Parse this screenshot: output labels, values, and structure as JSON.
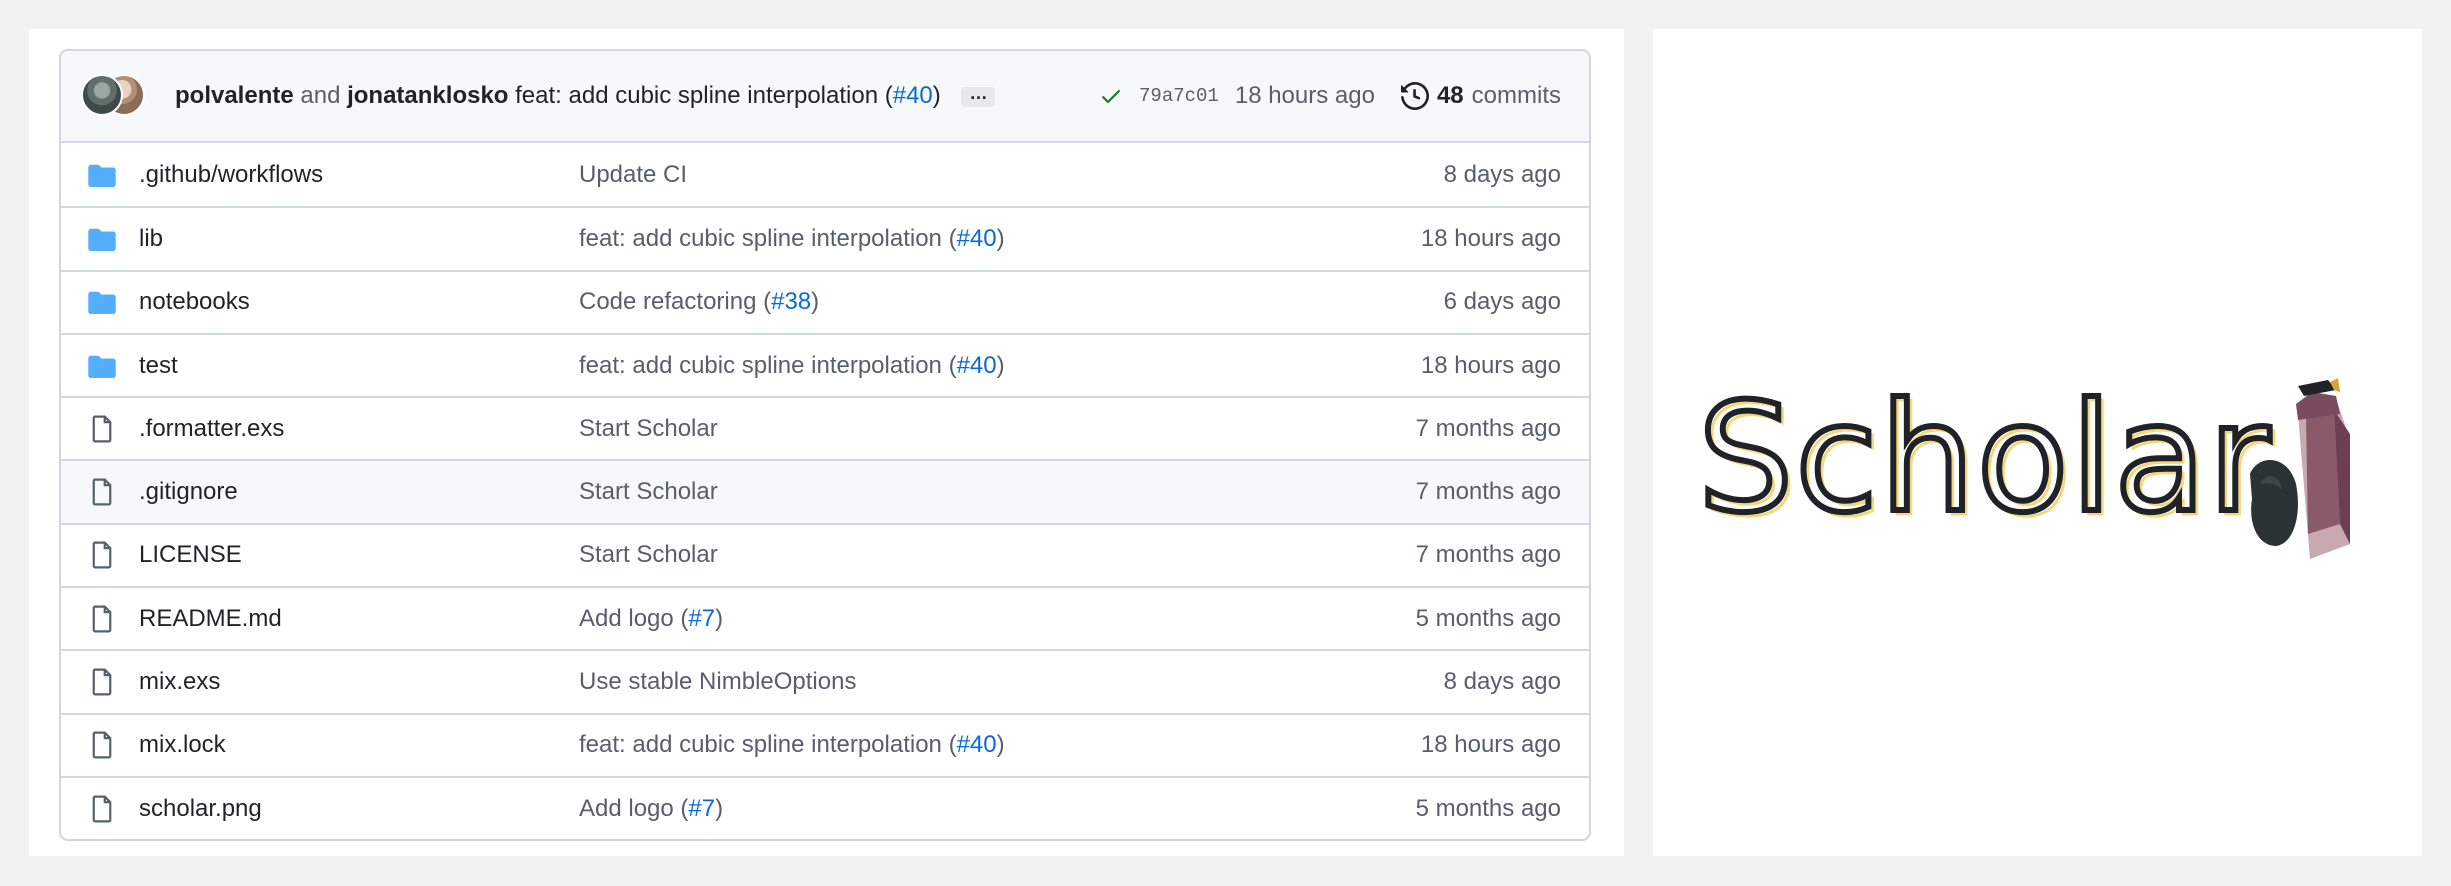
{
  "commit": {
    "author1": "polvalente",
    "and_text": "and",
    "author2": "jonatanklosko",
    "message": "feat: add cubic spline interpolation (",
    "pr": "#40",
    "message_end": ")",
    "ellipsis": "…",
    "sha": "79a7c01",
    "time": "18 hours ago",
    "commits_count": "48",
    "commits_label": "commits"
  },
  "files": [
    {
      "type": "folder",
      "name": ".github/workflows",
      "message": "Update CI",
      "pr": "",
      "age": "8 days ago"
    },
    {
      "type": "folder",
      "name": "lib",
      "message": "feat: add cubic spline interpolation (",
      "pr": "#40",
      "age": "18 hours ago"
    },
    {
      "type": "folder",
      "name": "notebooks",
      "message": "Code refactoring (",
      "pr": "#38",
      "age": "6 days ago"
    },
    {
      "type": "folder",
      "name": "test",
      "message": "feat: add cubic spline interpolation (",
      "pr": "#40",
      "age": "18 hours ago"
    },
    {
      "type": "file",
      "name": ".formatter.exs",
      "message": "Start Scholar",
      "pr": "",
      "age": "7 months ago"
    },
    {
      "type": "file",
      "name": ".gitignore",
      "message": "Start Scholar",
      "pr": "",
      "age": "7 months ago"
    },
    {
      "type": "file",
      "name": "LICENSE",
      "message": "Start Scholar",
      "pr": "",
      "age": "7 months ago"
    },
    {
      "type": "file",
      "name": "README.md",
      "message": "Add logo (",
      "pr": "#7",
      "age": "5 months ago"
    },
    {
      "type": "file",
      "name": "mix.exs",
      "message": "Use stable NimbleOptions",
      "pr": "",
      "age": "8 days ago"
    },
    {
      "type": "file",
      "name": "mix.lock",
      "message": "feat: add cubic spline interpolation (",
      "pr": "#40",
      "age": "18 hours ago"
    },
    {
      "type": "file",
      "name": "scholar.png",
      "message": "Add logo (",
      "pr": "#7",
      "age": "5 months ago"
    }
  ],
  "logo": {
    "text": "Scholar"
  },
  "colors": {
    "link": "#0969da",
    "folder": "#54aeff",
    "border": "#d0d7de",
    "check": "#1a7f37"
  },
  "icons": {
    "folder": "folder-icon",
    "file": "file-icon",
    "check": "check-icon",
    "history": "history-icon"
  }
}
